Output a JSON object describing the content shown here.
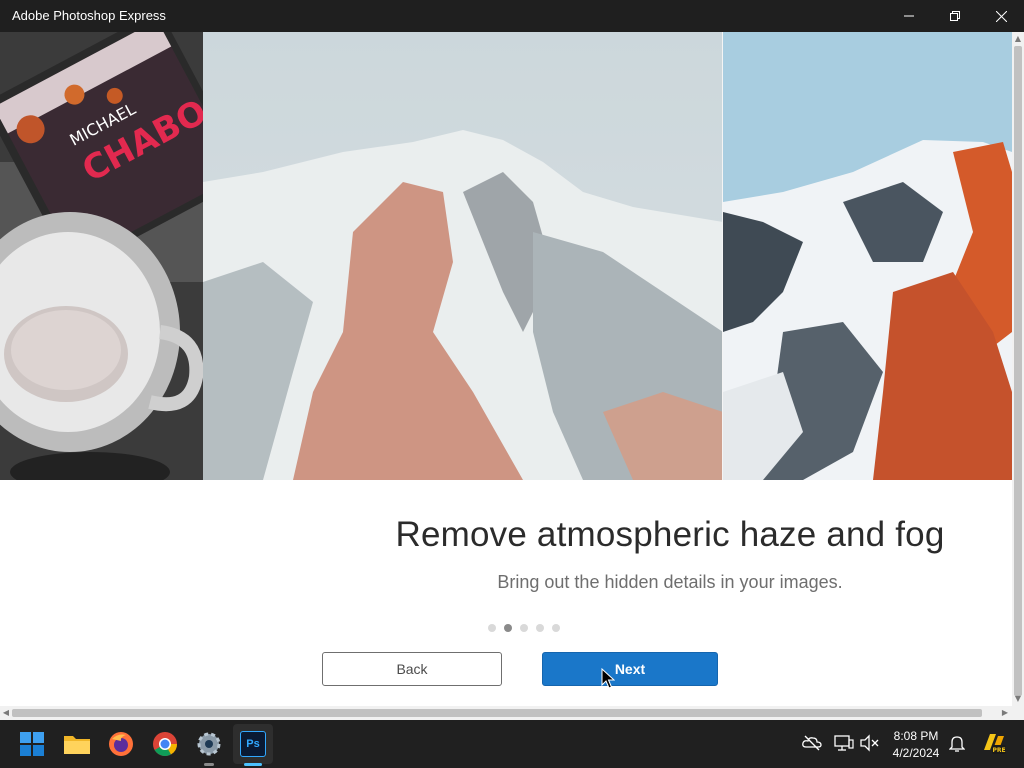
{
  "window": {
    "title": "Adobe Photoshop Express"
  },
  "onboarding": {
    "headline": "Remove atmospheric haze and fog",
    "subhead": "Bring out the hidden details in your images.",
    "page_dots": {
      "count": 5,
      "active_index": 1
    },
    "back_label": "Back",
    "next_label": "Next",
    "book_text": {
      "author_first": "MICHAEL",
      "author_last": "CHABO"
    }
  },
  "colors": {
    "accent": "#1a77c9",
    "titlebar": "#1f1f1f",
    "taskbar": "#202020"
  },
  "taskbar": {
    "apps": [
      {
        "name": "start-icon"
      },
      {
        "name": "file-explorer-icon"
      },
      {
        "name": "firefox-icon"
      },
      {
        "name": "chrome-icon"
      },
      {
        "name": "settings-icon"
      },
      {
        "name": "photoshop-express-icon",
        "glyph": "Ps"
      }
    ],
    "clock": {
      "time": "8:08 PM",
      "date": "4/2/2024"
    },
    "tray": [
      "onedrive-off-icon",
      "display-icon",
      "volume-muted-icon",
      "notifications-icon",
      "copilot-icon"
    ],
    "copilot_badge": "PRE"
  }
}
